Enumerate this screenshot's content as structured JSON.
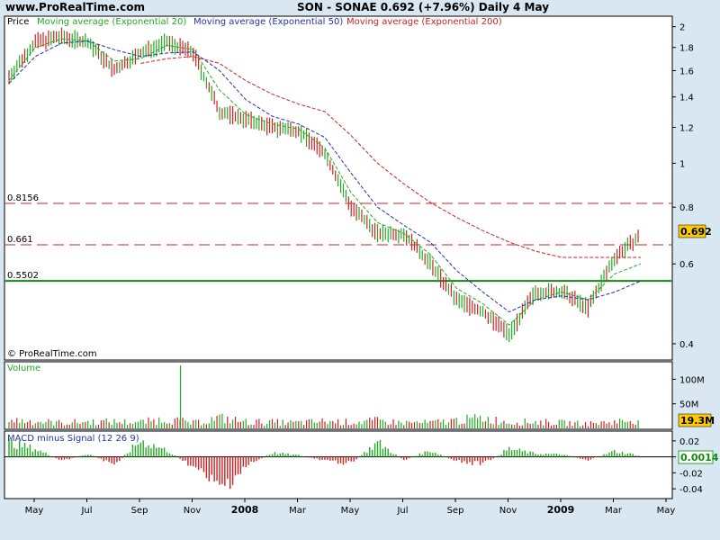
{
  "header": {
    "site": "www.ProRealTime.com",
    "symbol_line": "SON - SONAE    0.692 (+7.96%)    Daily  4 May"
  },
  "price_panel": {
    "label": "Price",
    "legend": [
      {
        "name": "Moving average (Exponential 20)",
        "color": "#22aa22"
      },
      {
        "name": "Moving average (Exponential 50)",
        "color": "#2233aa"
      },
      {
        "name": "Moving average (Exponential 200)",
        "color": "#cc2222"
      }
    ],
    "levels": [
      {
        "label": "0.8156",
        "value": 0.8156,
        "color": "#cc2222",
        "style": "dashed"
      },
      {
        "label": "0.661",
        "value": 0.661,
        "color": "#cc2222",
        "style": "dashed"
      },
      {
        "label": "0.5502",
        "value": 0.5502,
        "color": "#118811",
        "style": "solid"
      }
    ],
    "last_price": "0.692",
    "copyright": "© ProRealTime.com"
  },
  "volume_panel": {
    "label": "Volume",
    "last_value": "19.3M"
  },
  "macd_panel": {
    "label": "MACD minus Signal (12 26 9)",
    "last_value": "0.0014"
  },
  "chart_data": [
    {
      "type": "line",
      "scale": "log",
      "ylim": [
        0.37,
        2.1
      ],
      "y_ticks": [
        "2",
        "1.8",
        "1.6",
        "1.4",
        "1.2",
        "1",
        "0.8",
        "0.6",
        "0.4"
      ],
      "y_tick_values": [
        2,
        1.8,
        1.6,
        1.4,
        1.2,
        1,
        0.8,
        0.6,
        0.4
      ],
      "x_tick_labels": [
        "May",
        "Jul",
        "Sep",
        "Nov",
        "2008",
        "Mar",
        "May",
        "Jul",
        "Sep",
        "Nov",
        "2009",
        "Mar",
        "May"
      ],
      "x": [
        "2007-05",
        "2007-06",
        "2007-07",
        "2007-08",
        "2007-09",
        "2007-10",
        "2007-11",
        "2007-12",
        "2008-01",
        "2008-02",
        "2008-03",
        "2008-04",
        "2008-05",
        "2008-06",
        "2008-07",
        "2008-08",
        "2008-09",
        "2008-10",
        "2008-11",
        "2008-12",
        "2009-01",
        "2009-02",
        "2009-03",
        "2009-04",
        "2009-05"
      ],
      "series": [
        {
          "name": "Price",
          "color": "#22aa22",
          "values": [
            1.55,
            1.85,
            1.9,
            1.85,
            1.6,
            1.75,
            1.85,
            1.75,
            1.3,
            1.25,
            1.2,
            1.18,
            1.05,
            0.8,
            0.7,
            0.7,
            0.6,
            0.5,
            0.47,
            0.42,
            0.52,
            0.52,
            0.48,
            0.62,
            0.692
          ]
        },
        {
          "name": "Moving average (Exponential 20)",
          "color": "#22aa22",
          "values": [
            1.52,
            1.8,
            1.88,
            1.86,
            1.68,
            1.7,
            1.82,
            1.78,
            1.45,
            1.28,
            1.22,
            1.19,
            1.08,
            0.86,
            0.74,
            0.7,
            0.63,
            0.53,
            0.49,
            0.44,
            0.5,
            0.52,
            0.5,
            0.57,
            0.6
          ]
        },
        {
          "name": "Moving average (Exponential 50)",
          "color": "#2233aa",
          "values": [
            1.5,
            1.72,
            1.84,
            1.86,
            1.78,
            1.72,
            1.75,
            1.76,
            1.6,
            1.38,
            1.27,
            1.22,
            1.14,
            0.95,
            0.8,
            0.73,
            0.67,
            0.58,
            0.52,
            0.47,
            0.5,
            0.51,
            0.5,
            0.52,
            0.55
          ]
        },
        {
          "name": "Moving average (Exponential 200)",
          "color": "#cc2222",
          "values": [
            null,
            null,
            null,
            null,
            null,
            1.66,
            1.7,
            1.72,
            1.66,
            1.52,
            1.42,
            1.35,
            1.3,
            1.15,
            1.0,
            0.9,
            0.82,
            0.76,
            0.71,
            0.67,
            0.64,
            0.62,
            0.62,
            0.62,
            0.62
          ]
        }
      ]
    },
    {
      "type": "bar",
      "name": "Volume",
      "ylim": [
        0,
        130
      ],
      "y_ticks": [
        "100M",
        "50M"
      ],
      "y_tick_values": [
        100,
        50
      ],
      "x": [
        "2007-05",
        "2007-06",
        "2007-07",
        "2007-08",
        "2007-09",
        "2007-10",
        "2007-11",
        "2007-12",
        "2008-01",
        "2008-02",
        "2008-03",
        "2008-04",
        "2008-05",
        "2008-06",
        "2008-07",
        "2008-08",
        "2008-09",
        "2008-10",
        "2008-11",
        "2008-12",
        "2009-01",
        "2009-02",
        "2009-03",
        "2009-04",
        "2009-05"
      ],
      "values": [
        18,
        15,
        12,
        14,
        14,
        13,
        20,
        11,
        22,
        14,
        13,
        12,
        15,
        13,
        16,
        12,
        12,
        17,
        22,
        13,
        14,
        12,
        10,
        14,
        19.3
      ],
      "spike": {
        "x": "2007-11",
        "value": 128
      }
    },
    {
      "type": "bar",
      "name": "MACD minus Signal (12 26 9)",
      "ylim": [
        -0.05,
        0.03
      ],
      "y_ticks": [
        "0.02",
        "0",
        "-0.02",
        "-0.04"
      ],
      "y_tick_values": [
        0.02,
        0,
        -0.02,
        -0.04
      ],
      "x": [
        "2007-05",
        "2007-06",
        "2007-07",
        "2007-08",
        "2007-09",
        "2007-10",
        "2007-11",
        "2007-12",
        "2008-01",
        "2008-02",
        "2008-03",
        "2008-04",
        "2008-05",
        "2008-06",
        "2008-07",
        "2008-08",
        "2008-09",
        "2008-10",
        "2008-11",
        "2008-12",
        "2009-01",
        "2009-02",
        "2009-03",
        "2009-04",
        "2009-05"
      ],
      "values": [
        0.018,
        0.01,
        -0.005,
        0.004,
        -0.01,
        0.02,
        0.008,
        -0.012,
        -0.04,
        -0.012,
        0.005,
        0.002,
        -0.005,
        -0.008,
        0.018,
        -0.004,
        0.008,
        -0.006,
        -0.009,
        0.01,
        0.004,
        0.003,
        -0.004,
        0.007,
        0.0014
      ]
    }
  ]
}
